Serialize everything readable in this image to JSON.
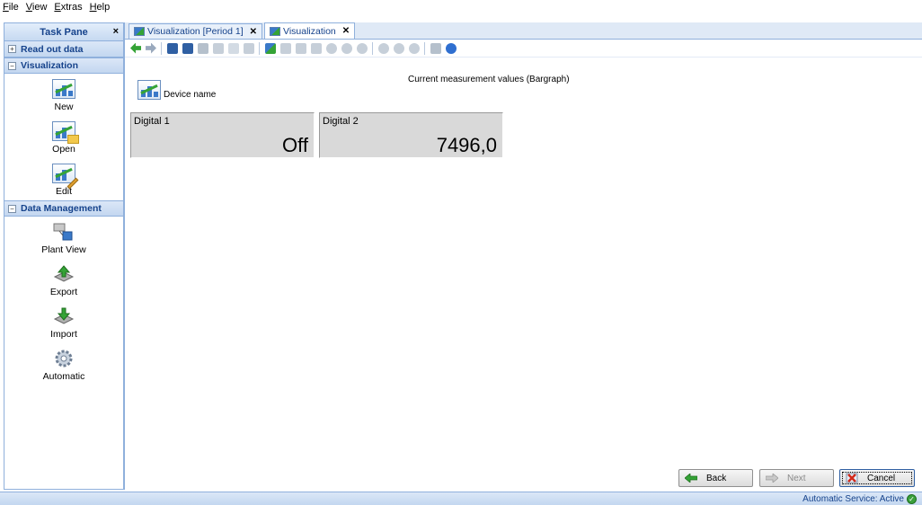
{
  "menubar": {
    "items": [
      {
        "label_u": "F",
        "label_rest": "ile"
      },
      {
        "label_u": "V",
        "label_rest": "iew"
      },
      {
        "label_u": "E",
        "label_rest": "xtras"
      },
      {
        "label_u": "H",
        "label_rest": "elp"
      }
    ]
  },
  "taskpane": {
    "title": "Task Pane",
    "close": "×",
    "sections": [
      {
        "title": "Read out data",
        "toggle": "+"
      },
      {
        "title": "Visualization",
        "toggle": "−",
        "items": [
          "New",
          "Open",
          "Edit"
        ]
      },
      {
        "title": "Data Management",
        "toggle": "−",
        "items": [
          "Plant View",
          "Export",
          "Import",
          "Automatic"
        ]
      }
    ]
  },
  "tabs": [
    {
      "label": "Visualization [Period 1]",
      "close": "✕"
    },
    {
      "label": "Visualization",
      "close": "✕"
    }
  ],
  "panel": {
    "title": "Current measurement values (Bargraph)",
    "device_name": "Device name",
    "tiles": [
      {
        "label": "Digital 1",
        "value": "Off"
      },
      {
        "label": "Digital 2",
        "value": "7496,0"
      }
    ]
  },
  "buttons": {
    "back": "Back",
    "next": "Next",
    "cancel": "Cancel"
  },
  "status": {
    "text": "Automatic Service: Active"
  },
  "colors": {
    "accent": "#15428b",
    "pane_border": "#8fb0dc",
    "tile_bg": "#d9d9d9"
  }
}
